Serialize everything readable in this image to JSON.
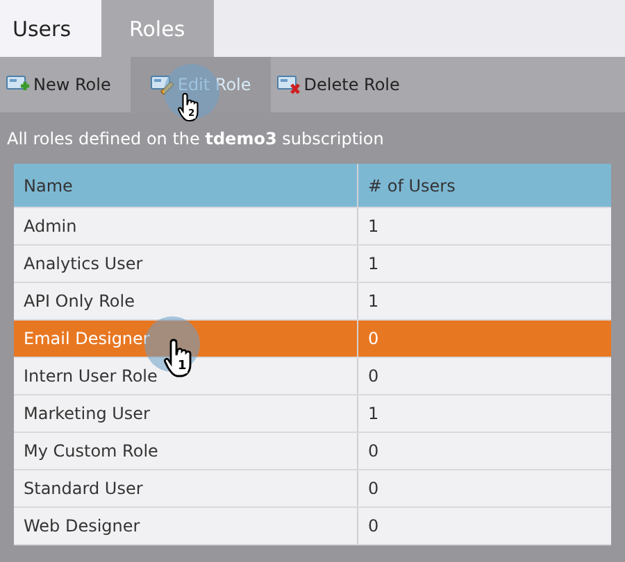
{
  "tabs": [
    {
      "label": "Users",
      "selected": false
    },
    {
      "label": "Roles",
      "selected": true
    }
  ],
  "toolbar": [
    {
      "label": "New Role",
      "kind": "new",
      "selected": false
    },
    {
      "label": "Edit Role",
      "kind": "edit",
      "selected": true
    },
    {
      "label": "Delete Role",
      "kind": "delete",
      "selected": false
    }
  ],
  "subtitle": "All roles defined on the **tdemo3** subscription",
  "table": {
    "columns": [
      "Name",
      "# of Users"
    ],
    "rows": [
      {
        "cells": [
          "Admin",
          "1"
        ],
        "selected": false
      },
      {
        "cells": [
          "Analytics User",
          "1"
        ],
        "selected": false
      },
      {
        "cells": [
          "API Only Role",
          "1"
        ],
        "selected": false
      },
      {
        "cells": [
          "Email Designer",
          "0"
        ],
        "selected": true
      },
      {
        "cells": [
          "Intern User Role",
          "0"
        ],
        "selected": false
      },
      {
        "cells": [
          "Marketing User",
          "1"
        ],
        "selected": false
      },
      {
        "cells": [
          "My Custom Role",
          "0"
        ],
        "selected": false
      },
      {
        "cells": [
          "Standard User",
          "0"
        ],
        "selected": false
      },
      {
        "cells": [
          "Web Designer",
          "0"
        ],
        "selected": false
      }
    ]
  },
  "callouts": [
    "2",
    "1"
  ]
}
